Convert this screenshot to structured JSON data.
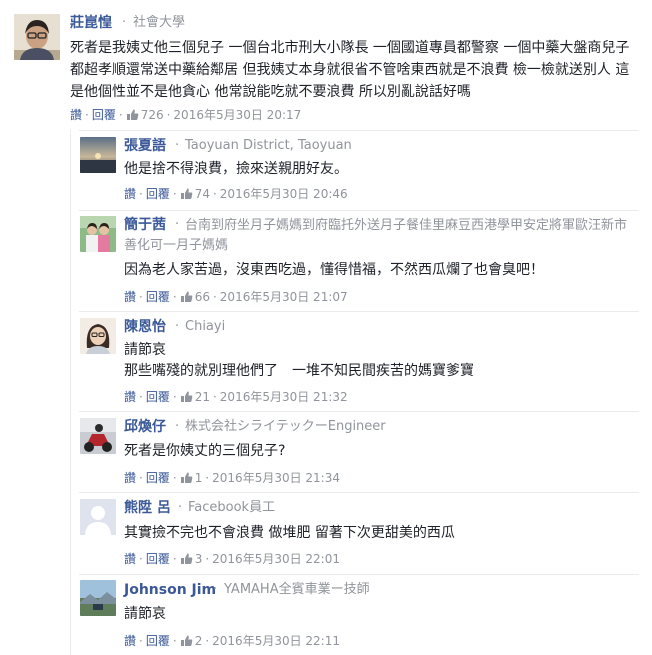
{
  "comments": [
    {
      "name": "莊崑惶",
      "meta": "社會大學",
      "text": "死者是我姨丈他三個兒子 一個台北市刑大小隊長 一個國道專員都警察 一個中藥大盤商兒子都超孝順還常送中藥給鄰居 但我姨丈本身就很省不管啥東西就是不浪費 檢一檢就送別人 這是他個性並不是他貪心 他常說能吃就不要浪費 所以別亂說話好嗎",
      "like_label": "讚",
      "reply_label": "回覆",
      "likes": "726",
      "time": "2016年5月30日 20:17"
    },
    {
      "name": "張夏語",
      "meta": "Taoyuan District, Taoyuan",
      "text": "他是捨不得浪費，撿來送親朋好友。",
      "like_label": "讚",
      "reply_label": "回覆",
      "likes": "74",
      "time": "2016年5月30日 20:46"
    },
    {
      "name": "簡于茜",
      "meta": "台南到府坐月子媽媽到府臨托外送月子餐佳里麻豆西港學甲安定將軍歐汪新市善化可一月子媽媽",
      "text": "因為老人家苦過，沒東西吃過，懂得惜福，不然西瓜爛了也會臭吧！",
      "like_label": "讚",
      "reply_label": "回覆",
      "likes": "66",
      "time": "2016年5月30日 21:07"
    },
    {
      "name": "陳恩怡",
      "meta": "Chiayi",
      "text_line1": "請節哀",
      "text_line2": "那些嘴殘的就別理他們了　一堆不知民間疾苦的媽寶爹寶",
      "like_label": "讚",
      "reply_label": "回覆",
      "likes": "21",
      "time": "2016年5月30日 21:32"
    },
    {
      "name": "邱煥仔",
      "meta": "株式会社シライテックーEngineer",
      "text": "死者是你姨丈的三個兒子?",
      "like_label": "讚",
      "reply_label": "回覆",
      "likes": "1",
      "time": "2016年5月30日 21:34"
    },
    {
      "name": "熊陞 呂",
      "meta": "Facebook員工",
      "text": "其實撿不完也不會浪費 做堆肥 留著下次更甜美的西瓜",
      "like_label": "讚",
      "reply_label": "回覆",
      "likes": "3",
      "time": "2016年5月30日 22:01"
    },
    {
      "name": "Johnson Jim",
      "meta": "YAMAHA全賓車業ー技師",
      "text": "請節哀",
      "like_label": "讚",
      "reply_label": "回覆",
      "likes": "2",
      "time": "2016年5月30日 22:11"
    }
  ],
  "separator_dot": "·",
  "colors": {
    "link": "#3b5998",
    "meta": "#90949c",
    "text": "#1d2129",
    "divider": "#e9ebee"
  }
}
